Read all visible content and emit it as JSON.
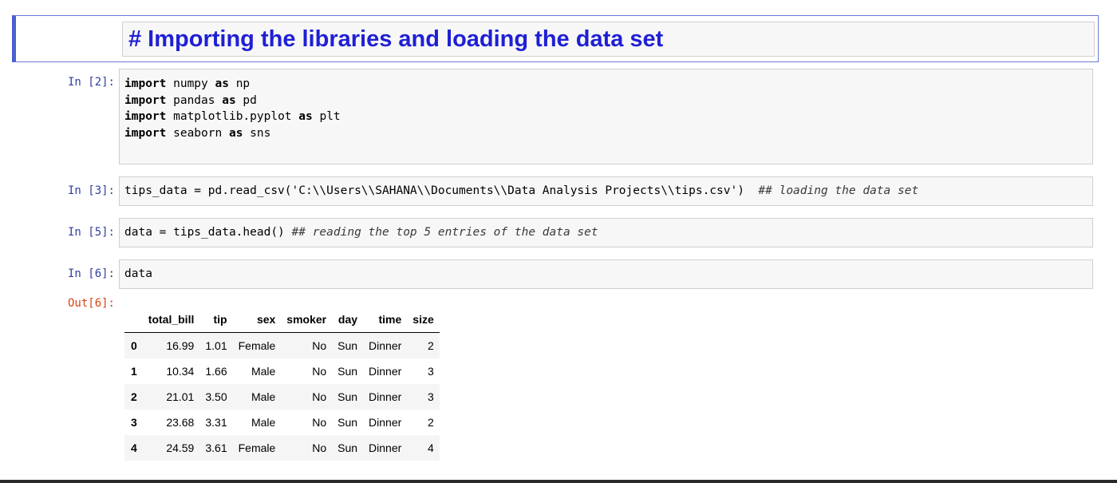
{
  "markdown_cell": {
    "heading": "# Importing the libraries and loading the data set"
  },
  "cells": [
    {
      "prompt": "In [2]:",
      "lines": [
        {
          "kw": "import",
          "rest": " numpy ",
          "kw2": "as",
          "rest2": " np"
        },
        {
          "kw": "import",
          "rest": " pandas ",
          "kw2": "as",
          "rest2": " pd"
        },
        {
          "kw": "import",
          "rest": " matplotlib.pyplot ",
          "kw2": "as",
          "rest2": " plt"
        },
        {
          "kw": "import",
          "rest": " seaborn ",
          "kw2": "as",
          "rest2": " sns"
        }
      ]
    },
    {
      "prompt": "In [3]:",
      "code": "tips_data = pd.read_csv('C:\\\\Users\\\\SAHANA\\\\Documents\\\\Data Analysis Projects\\\\tips.csv')  ",
      "comment": "## loading the data set"
    },
    {
      "prompt": "In [5]:",
      "code": "data = tips_data.head() ",
      "comment": "## reading the top 5 entries of the data set"
    },
    {
      "prompt": "In [6]:",
      "code": "data"
    }
  ],
  "output": {
    "prompt": "Out[6]:",
    "columns": [
      "",
      "total_bill",
      "tip",
      "sex",
      "smoker",
      "day",
      "time",
      "size"
    ],
    "rows": [
      [
        "0",
        "16.99",
        "1.01",
        "Female",
        "No",
        "Sun",
        "Dinner",
        "2"
      ],
      [
        "1",
        "10.34",
        "1.66",
        "Male",
        "No",
        "Sun",
        "Dinner",
        "3"
      ],
      [
        "2",
        "21.01",
        "3.50",
        "Male",
        "No",
        "Sun",
        "Dinner",
        "3"
      ],
      [
        "3",
        "23.68",
        "3.31",
        "Male",
        "No",
        "Sun",
        "Dinner",
        "2"
      ],
      [
        "4",
        "24.59",
        "3.61",
        "Female",
        "No",
        "Sun",
        "Dinner",
        "4"
      ]
    ]
  },
  "colors": {
    "heading": "#1f1fd6",
    "selected_border": "#4b5fd1",
    "in_prompt": "#303f9f",
    "out_prompt": "#d84315"
  }
}
